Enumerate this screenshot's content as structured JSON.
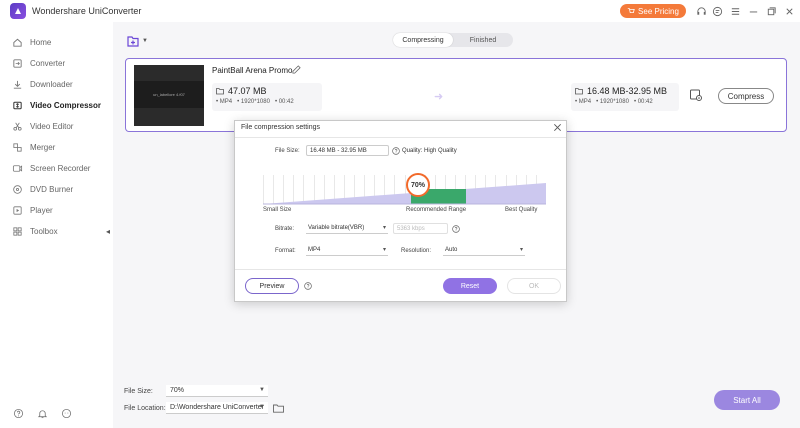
{
  "app": {
    "title": "Wondershare UniConverter",
    "pricing_label": "See Pricing"
  },
  "titlebar_icons": [
    "headset-icon",
    "mail-icon",
    "menu-icon",
    "minimize-icon",
    "maximize-icon",
    "close-icon"
  ],
  "sidebar": {
    "items": [
      {
        "label": "Home",
        "icon": "home-icon"
      },
      {
        "label": "Converter",
        "icon": "converter-icon"
      },
      {
        "label": "Downloader",
        "icon": "download-icon"
      },
      {
        "label": "Video Compressor",
        "icon": "compress-icon",
        "active": true
      },
      {
        "label": "Video Editor",
        "icon": "scissors-icon"
      },
      {
        "label": "Merger",
        "icon": "merge-icon"
      },
      {
        "label": "Screen Recorder",
        "icon": "record-icon"
      },
      {
        "label": "DVD Burner",
        "icon": "disc-icon"
      },
      {
        "label": "Player",
        "icon": "play-icon"
      },
      {
        "label": "Toolbox",
        "icon": "grid-icon"
      }
    ]
  },
  "tabs": {
    "compressing": "Compressing",
    "finished": "Finished"
  },
  "video": {
    "name": "PaintBall Arena Promo",
    "thumbnail_text": "un_labellore 4.f07",
    "source": {
      "size": "47.07 MB",
      "format": "MP4",
      "resolution": "1920*1080",
      "duration": "00:42"
    },
    "target": {
      "size": "16.48 MB-32.95 MB",
      "format": "MP4",
      "resolution": "1920*1080",
      "duration": "00:42"
    },
    "compress_label": "Compress"
  },
  "dialog": {
    "title": "File compression settings",
    "file_size_label": "File Size:",
    "file_size_value": "16.48 MB - 32.95 MB",
    "quality_text": "Quality: High Quality",
    "percent": "70%",
    "slider_level": 0.7,
    "scale": {
      "small": "Small Size",
      "recommended": "Recommended Range",
      "best": "Best Quality"
    },
    "bitrate_label": "Bitrate:",
    "bitrate_value": "Variable bitrate(VBR)",
    "bitrate_input": "5363 kbps",
    "format_label": "Format:",
    "format_value": "MP4",
    "resolution_label": "Resolution:",
    "resolution_value": "Auto",
    "preview_label": "Preview",
    "reset_label": "Reset",
    "ok_label": "OK"
  },
  "bottom": {
    "file_size_label": "File Size:",
    "file_size_value": "70%",
    "file_location_label": "File Location:",
    "file_location_value": "D:\\Wondershare UniConverter",
    "start_all_label": "Start All"
  },
  "colors": {
    "accent": "#6b47d6",
    "pricing": "#f47a3a",
    "range": "#3aa86b",
    "bubble_border": "#f26a2b"
  }
}
